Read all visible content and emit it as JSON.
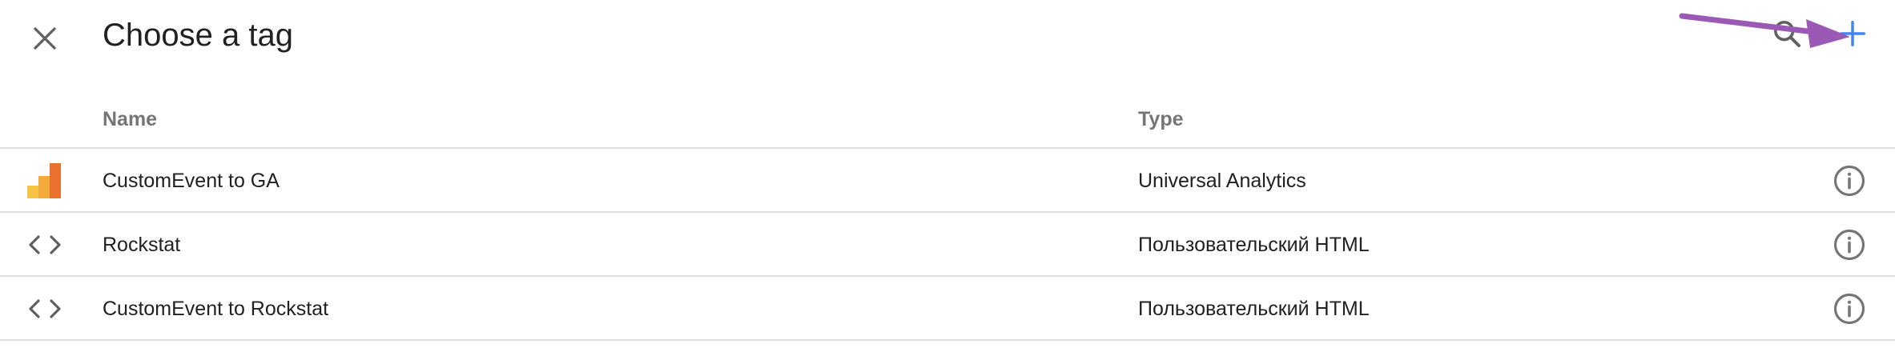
{
  "header": {
    "title": "Choose a tag",
    "close_icon": "close-icon",
    "search_icon": "search-icon",
    "add_icon": "plus-icon",
    "accent_color": "#4285f4",
    "annotation_color": "#9b59b6"
  },
  "table": {
    "columns": [
      "Name",
      "Type"
    ],
    "rows": [
      {
        "name": "CustomEvent to GA",
        "type": "Universal Analytics",
        "icon": "analytics-icon"
      },
      {
        "name": "Rockstat",
        "type": "Пользовательский HTML",
        "icon": "code-icon"
      },
      {
        "name": "CustomEvent to Rockstat",
        "type": "Пользовательский HTML",
        "icon": "code-icon"
      }
    ]
  }
}
